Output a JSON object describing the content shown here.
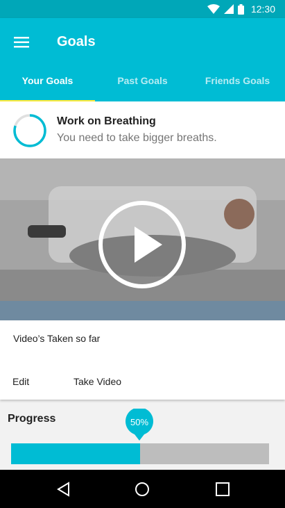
{
  "status_bar": {
    "time": "12:30"
  },
  "app_bar": {
    "title": "Goals",
    "menu_icon": "menu-icon"
  },
  "tabs": [
    {
      "label": "Your Goals",
      "active": true
    },
    {
      "label": "Past Goals",
      "active": false
    },
    {
      "label": "Friends Goals",
      "active": false
    }
  ],
  "goal": {
    "title": "Work on Breathing",
    "subtitle": "You need to take bigger breaths.",
    "ring_progress": 0.8
  },
  "video": {
    "play_icon": "play-icon"
  },
  "video_info": {
    "count_label": "Video’s Taken so far",
    "edit_label": "Edit",
    "take_video_label": "Take Video"
  },
  "progress": {
    "label": "Progress",
    "value_text": "50%",
    "fraction": 0.5
  },
  "nav": {
    "back_icon": "back-icon",
    "home_icon": "home-icon",
    "recents_icon": "recents-icon"
  },
  "colors": {
    "primary": "#00bcd4",
    "primary_dark": "#00a7b8",
    "tab_indicator": "#ffeb3b",
    "track": "#bdbdbd"
  }
}
